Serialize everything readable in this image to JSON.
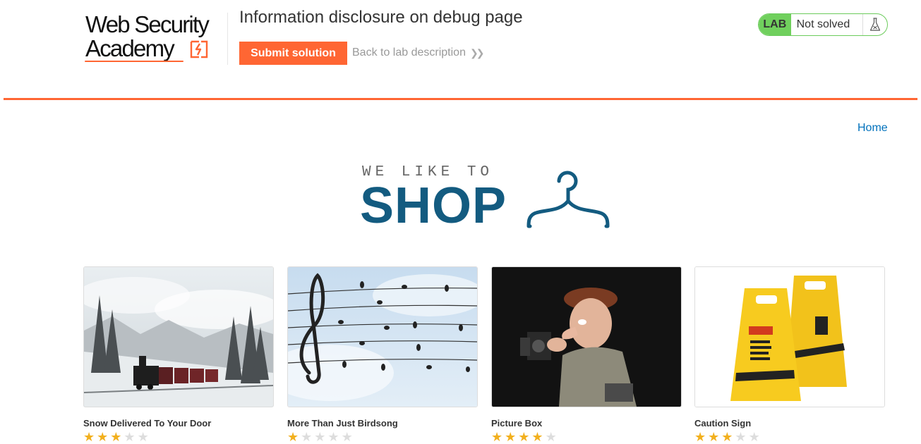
{
  "header": {
    "logo_line1": "Web Security",
    "logo_line2": "Academy",
    "lab_title": "Information disclosure on debug page",
    "submit_label": "Submit solution",
    "back_label": "Back to lab description",
    "lab_badge": "LAB",
    "status": "Not solved"
  },
  "nav": {
    "home": "Home"
  },
  "hero": {
    "tagline": "WE LIKE TO",
    "title": "SHOP"
  },
  "colors": {
    "accent": "#ff6633",
    "brand_blue": "#135b80",
    "lab_green": "#70d05d",
    "link": "#0071bc",
    "star": "#f2b01e"
  },
  "products": [
    {
      "name": "Snow Delivered To Your Door",
      "rating": 3,
      "max_rating": 5
    },
    {
      "name": "More Than Just Birdsong",
      "rating": 1,
      "max_rating": 5
    },
    {
      "name": "Picture Box",
      "rating": 4,
      "max_rating": 5
    },
    {
      "name": "Caution Sign",
      "rating": 3,
      "max_rating": 5
    }
  ],
  "icons": [
    "lab-flask-icon",
    "chevron-double-right-icon",
    "hanger-icon",
    "star-icon"
  ]
}
